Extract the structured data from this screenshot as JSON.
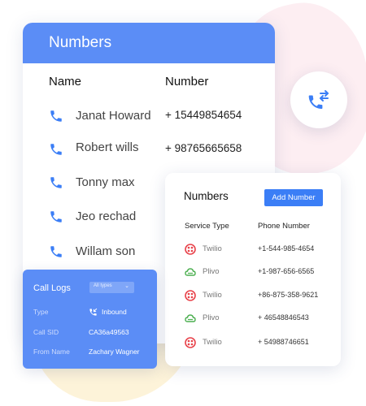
{
  "colors": {
    "accent": "#5b8df6",
    "button": "#3b7ef6",
    "twilio": "#e8424a",
    "plivo": "#4caf50"
  },
  "contacts": {
    "title": "Numbers",
    "col_name": "Name",
    "col_number": "Number",
    "rows": [
      {
        "name": "Janat Howard",
        "number": "+ 15449854654"
      },
      {
        "name": "Robert wills",
        "number": "+ 98765665658"
      },
      {
        "name": "Tonny max",
        "number": ""
      },
      {
        "name": "Jeo rechad",
        "number": ""
      },
      {
        "name": "Willam son",
        "number": ""
      }
    ]
  },
  "numbers_panel": {
    "title": "Numbers",
    "add_button": "Add Number",
    "col_service": "Service Type",
    "col_phone": "Phone Number",
    "rows": [
      {
        "service": "Twilio",
        "icon": "twilio-icon",
        "phone": "+1-544-985-4654"
      },
      {
        "service": "Plivo",
        "icon": "plivo-icon",
        "phone": "+1-987-656-6565"
      },
      {
        "service": "Twilio",
        "icon": "twilio-icon",
        "phone": "+86-875-358-9621"
      },
      {
        "service": "Plivo",
        "icon": "plivo-icon",
        "phone": "+ 46548846543"
      },
      {
        "service": "Twilio",
        "icon": "twilio-icon",
        "phone": "+ 54988746651"
      }
    ]
  },
  "call_logs": {
    "title": "Call Logs",
    "filter": "All types",
    "type_label": "Type",
    "type_value": "Inbound",
    "sid_label": "Call SID",
    "sid_value": "CA36a49563",
    "from_label": "From Name",
    "from_value": "Zachary Wagner"
  },
  "icons": {
    "float": "call-transfer-icon",
    "row": "phone-icon",
    "inbound": "incoming-call-icon"
  }
}
